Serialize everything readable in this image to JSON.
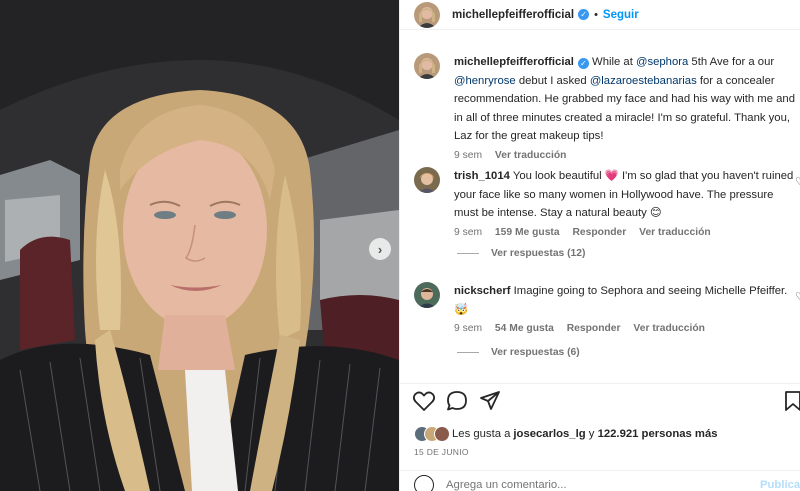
{
  "post": {
    "username": "michellepfeifferofficial",
    "follow_label": "Seguir",
    "separator": "•"
  },
  "caption": {
    "username": "michellepfeifferofficial",
    "text_1": "While at ",
    "mention_1": "@sephora",
    "text_2": " 5th Ave for a our ",
    "mention_2": "@henryrose",
    "text_3": " debut I asked ",
    "mention_3": "@lazaroestebanarias",
    "text_4": " for a concealer recommendation. He grabbed my face and had his way with me and in all of three minutes created a miracle! I'm so grateful. Thank you, Laz for the great makeup tips!",
    "time": "9 sem",
    "translate": "Ver traducción"
  },
  "comments": [
    {
      "username": "trish_1014",
      "text": "You look beautiful 💗  I'm so glad that you haven't ruined your face like so many women in Hollywood have. The pressure must be intense. Stay a natural beauty 😊",
      "time": "9 sem",
      "likes": "159 Me gusta",
      "reply": "Responder",
      "translate": "Ver traducción",
      "replies": "Ver respuestas (12)"
    },
    {
      "username": "nickscherf",
      "text": "Imagine going to Sephora and seeing Michelle Pfeiffer. 🤯",
      "time": "9 sem",
      "likes": "54 Me gusta",
      "reply": "Responder",
      "translate": "Ver traducción",
      "replies": "Ver respuestas (6)"
    }
  ],
  "likes": {
    "prefix": "Les gusta a ",
    "user": "josecarlos_lg",
    "middle": " y ",
    "count": "122.921 personas más"
  },
  "date": "15 DE JUNIO",
  "comment_box": {
    "placeholder": "Agrega un comentario...",
    "publish": "Publicar"
  },
  "icons": {
    "like": "heart-icon",
    "comment": "comment-icon",
    "share": "share-icon",
    "save": "bookmark-icon",
    "emoji": "emoji-icon",
    "next": "chevron-right-icon"
  },
  "colors": {
    "link": "#00376b",
    "follow": "#0095f6",
    "verified": "#3897f0",
    "meta": "#737373"
  }
}
